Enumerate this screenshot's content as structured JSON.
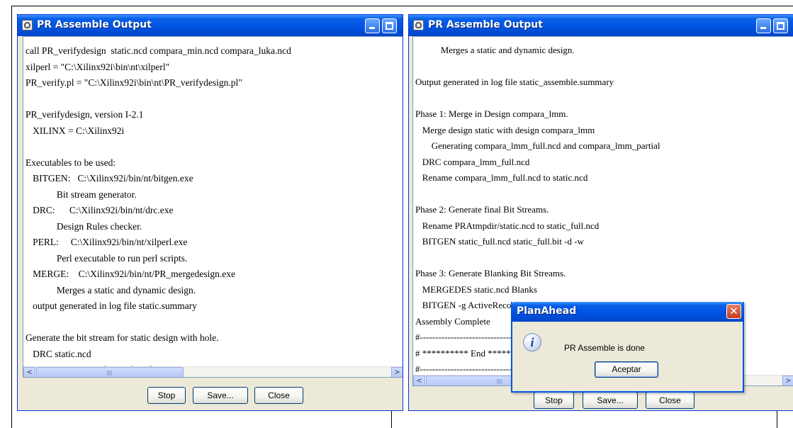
{
  "left_window": {
    "title": "PR Assemble Output",
    "lines": [
      "call PR_verifydesign  static.ncd compara_min.ncd compara_luka.ncd",
      "xilperl = \"C:\\Xilinx92i\\bin\\nt\\xilperl\"",
      "PR_verify.pl = \"C:\\Xilinx92i\\bin\\nt\\PR_verifydesign.pl\"",
      "",
      "PR_verifydesign, version I-2.1",
      "   XILINX = C:\\Xilinx92i",
      "",
      "Executables to be used:",
      "   BITGEN:   C:\\Xilinx92i/bin/nt/bitgen.exe",
      "             Bit stream generator.",
      "   DRC:      C:\\Xilinx92i/bin/nt/drc.exe",
      "             Design Rules checker.",
      "   PERL:     C:\\Xilinx92i/bin/nt/xilperl.exe",
      "             Perl executable to run perl scripts.",
      "   MERGE:    C:\\Xilinx92i/bin/nt/PR_mergedesign.exe",
      "             Merges a static and dynamic design.",
      "   output generated in log file static.summary",
      "",
      "Generate the bit stream for static design with hole.",
      "   DRC static.ncd",
      "   BITGEN static.ncd static.bit -d -w"
    ],
    "buttons": {
      "stop": "Stop",
      "save": "Save...",
      "close": "Close"
    }
  },
  "right_window": {
    "title": "PR Assemble Output",
    "lines": [
      "           Merges a static and dynamic design.",
      "",
      "Output generated in log file static_assemble.summary",
      "",
      "Phase 1: Merge in Design compara_lmm.",
      "   Merge design static with design compara_lmm",
      "       Generating compara_lmm_full.ncd and compara_lmm_partial",
      "   DRC compara_lmm_full.ncd",
      "   Rename compara_lmm_full.ncd to static.ncd",
      "",
      "Phase 2: Generate final Bit Streams.",
      "   Rename PRAtmpdir/static.ncd to static_full.ncd",
      "   BITGEN static_full.ncd static_full.bit -d -w",
      "",
      "Phase 3: Generate Blanking Bit Streams.",
      "   MERGEDES static.ncd Blanks",
      "   BITGEN -g ActiveReconfig:Yes pblock_compara_blank.ncd pblock",
      "Assembly Complete",
      "#------------------------------------------------------------------",
      "# ********** End ************************************************",
      "#------------------------------------------------------------------"
    ],
    "buttons": {
      "stop": "Stop",
      "save": "Save...",
      "close": "Close"
    }
  },
  "dialog": {
    "title": "PlanAhead",
    "message": "PR Assemble is done",
    "ok_button": "Aceptar",
    "icon": "info-icon"
  },
  "colors": {
    "xp_title_blue": "#0054e3",
    "window_face": "#ece9d8",
    "close_red": "#c63b1e"
  }
}
